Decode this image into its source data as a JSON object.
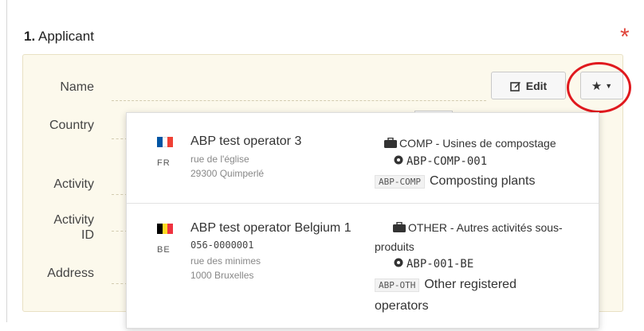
{
  "section": {
    "number": "1.",
    "title": "Applicant",
    "required_mark": "*"
  },
  "fields": [
    "Name",
    "Country",
    "Activity",
    "Activity\nID",
    "Address"
  ],
  "buttons": {
    "edit_label": "Edit",
    "favorites_icon": "star-icon"
  },
  "operators": [
    {
      "flag": [
        "#0055a4",
        "#ffffff",
        "#ef4135"
      ],
      "country_code": "FR",
      "name": "ABP test operator 3",
      "id": "",
      "street": "rue de l'église",
      "city": "29300 Quimperlé",
      "section_lines": [
        "COMP - Usines de compostage"
      ],
      "activity_code": "ABP-COMP-001",
      "activity_tag": "ABP-COMP",
      "activity_lines": [
        "Composting plants"
      ]
    },
    {
      "flag": [
        "#000000",
        "#fdda24",
        "#ef3340"
      ],
      "country_code": "BE",
      "name": "ABP test operator Belgium 1",
      "id": "056-0000001",
      "street": "rue des minimes",
      "city": "1000 Bruxelles",
      "section_lines": [
        "OTHER - Autres activités sous-",
        "produits"
      ],
      "activity_code": "ABP-001-BE",
      "activity_tag": "ABP-OTH",
      "activity_lines": [
        "Other registered",
        "operators"
      ]
    }
  ]
}
